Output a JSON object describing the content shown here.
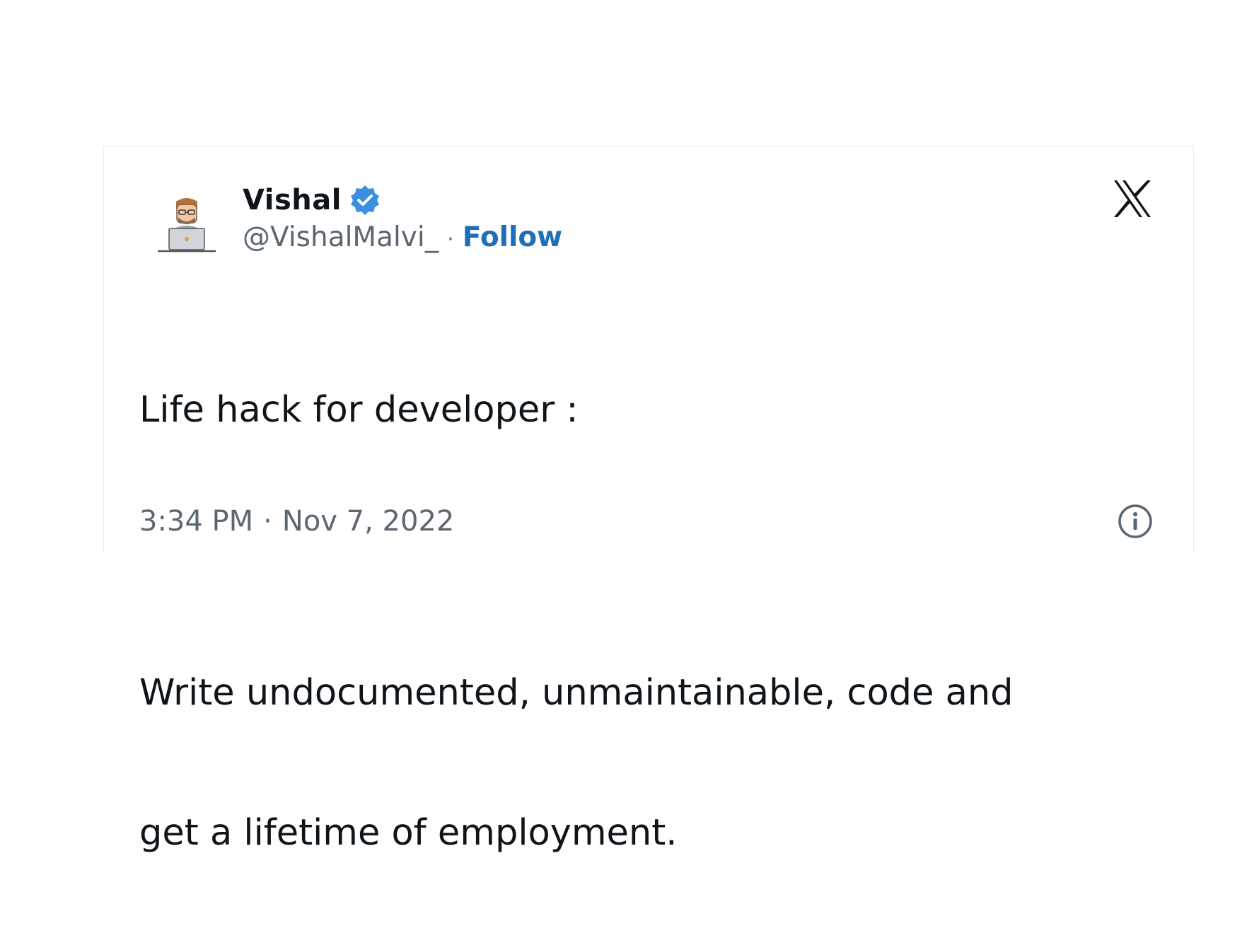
{
  "tweet": {
    "author": {
      "display_name": "Vishal",
      "handle": "@VishalMalvi_",
      "verified": true,
      "avatar_icon": "developer-at-laptop-avatar-icon"
    },
    "header_separator": "·",
    "follow_label": "Follow",
    "brand_icon": "x-logo-icon",
    "text_line_1": "Life hack for developer :",
    "text_line_2": "Write undocumented, unmaintainable, code and",
    "text_line_3": "get a lifetime of employment.",
    "time": "3:34 PM",
    "timestamp_separator": "·",
    "date": "Nov 7, 2022",
    "info_icon": "info-icon"
  },
  "colors": {
    "text_primary": "#0f1419",
    "text_secondary": "#5b6670",
    "link": "#1d6fb8",
    "verified_badge": "#3b8fe0"
  }
}
